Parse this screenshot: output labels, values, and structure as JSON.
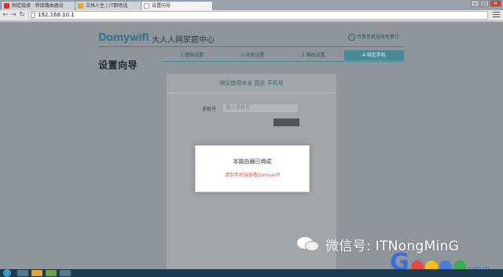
{
  "browser": {
    "tabs": [
      {
        "title": "固定链接 · 转接路由器设",
        "active": false
      },
      {
        "title": "文档人生 | IT职场话",
        "active": false
      },
      {
        "title": "设置向导",
        "active": true
      }
    ],
    "address": "192.168.10.1",
    "window_buttons": {
      "minimize": "–",
      "maximize": "□",
      "close": "✕"
    }
  },
  "header": {
    "brand": "Domywifi",
    "subtitle": "大人人网家庭中心",
    "quick_link": "专享手机无线免费行"
  },
  "wizard": {
    "title": "设置向导",
    "steps": [
      {
        "label": "1 基础设置",
        "active": false
      },
      {
        "label": "2 共享设置",
        "active": false
      },
      {
        "label": "3 路由设置",
        "active": false
      },
      {
        "label": "4 绑定手机",
        "active": true
      }
    ],
    "panel_subtitle": "保证使用安全  因此  手机号",
    "phone_label": "手机号",
    "phone_placeholder": "输入手机号"
  },
  "modal": {
    "title": "本路由器已绑成",
    "message": "请到手机端查看Domywifi"
  },
  "watermark": {
    "text": "微信号: ITNongMinG",
    "suffix": ".com.cn"
  },
  "colors": {
    "accent": "#4a8a97",
    "brand": "#39758a",
    "error": "#d9534f"
  }
}
